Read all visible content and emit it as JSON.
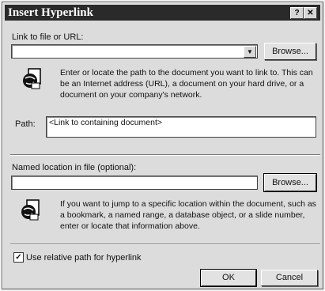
{
  "window": {
    "title": "Insert Hyperlink",
    "help_glyph": "?",
    "close_glyph": "✕"
  },
  "link": {
    "label": "Link to file or URL:",
    "value": "",
    "browse_label": "Browse...",
    "description": "Enter or locate the path to the document you want to link to. This can be an Internet address (URL), a document on your hard drive, or a document on your company's network.",
    "icon": "globe-document-icon",
    "path_label": "Path:",
    "path_value": "<Link to containing document>"
  },
  "named": {
    "label": "Named location in file (optional):",
    "value": "",
    "browse_label": "Browse...",
    "description": "If you want to jump to a specific location within the document, such as a bookmark, a named range, a database object, or a slide number, enter or locate that information above.",
    "icon": "globe-document-icon"
  },
  "options": {
    "relative_path_label": "Use relative path for hyperlink",
    "relative_path_checked": true,
    "check_glyph": "✓"
  },
  "buttons": {
    "ok": "OK",
    "cancel": "Cancel"
  }
}
